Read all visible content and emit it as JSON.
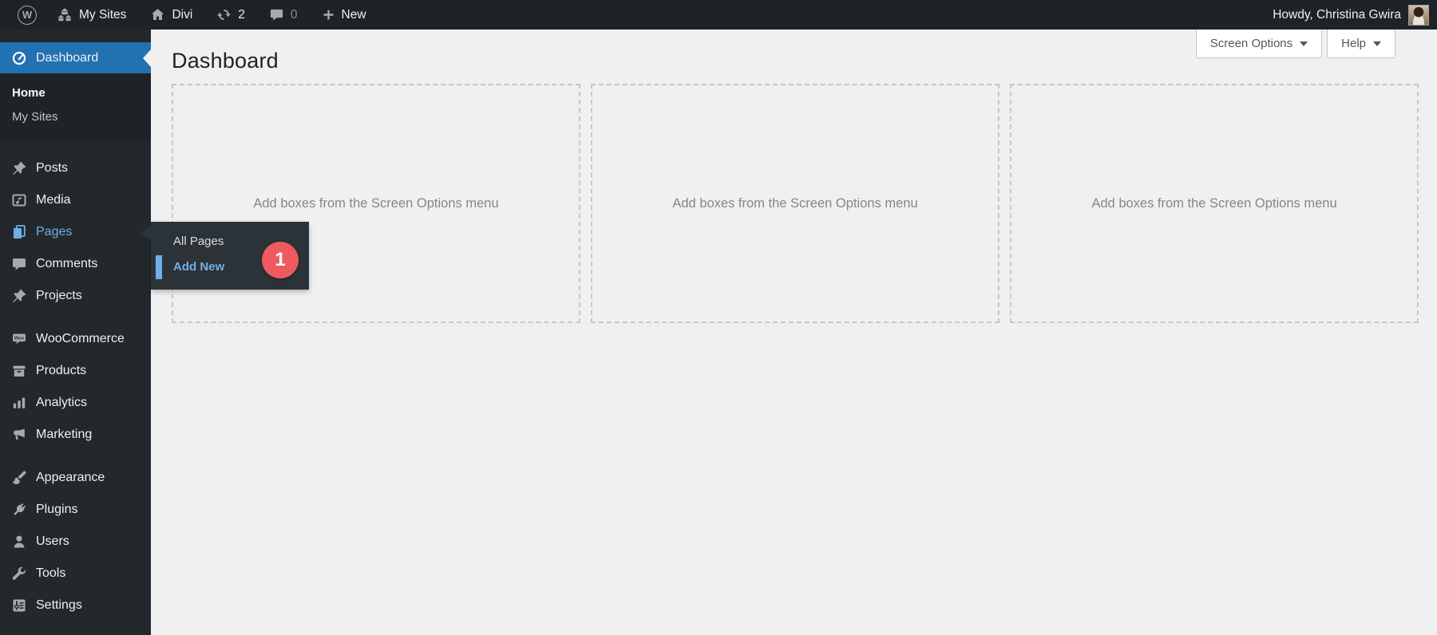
{
  "admin_bar": {
    "wp_logo_letter": "W",
    "my_sites_label": "My Sites",
    "site_name": "Divi",
    "update_count": "2",
    "comment_count": "0",
    "new_label": "New",
    "howdy": "Howdy, Christina Gwira"
  },
  "sidebar": {
    "dashboard_label": "Dashboard",
    "submenu": {
      "home": "Home",
      "my_sites": "My Sites"
    },
    "menu": [
      {
        "label": "Posts"
      },
      {
        "label": "Media"
      },
      {
        "label": "Pages"
      },
      {
        "label": "Comments"
      },
      {
        "label": "Projects"
      },
      {
        "label": "WooCommerce"
      },
      {
        "label": "Products"
      },
      {
        "label": "Analytics"
      },
      {
        "label": "Marketing"
      },
      {
        "label": "Appearance"
      },
      {
        "label": "Plugins"
      },
      {
        "label": "Users"
      },
      {
        "label": "Tools"
      },
      {
        "label": "Settings"
      }
    ]
  },
  "flyout": {
    "all_pages_label": "All Pages",
    "add_new_label": "Add New",
    "badge": "1"
  },
  "main": {
    "title": "Dashboard",
    "screen_options_label": "Screen Options",
    "help_label": "Help",
    "boxes": [
      {
        "text": "Add boxes from the Screen Options menu"
      },
      {
        "text": "Add boxes from the Screen Options menu"
      },
      {
        "text": "Add boxes from the Screen Options menu"
      }
    ]
  },
  "colors": {
    "admin_bar_bg": "#1d2327",
    "sidebar_bg": "#23282d",
    "submenu_bg": "#1d2327",
    "flyout_bg": "#2c3338",
    "active_blue": "#2271b1",
    "link_blue": "#72aee6",
    "badge_red": "#ee5a5f",
    "content_bg": "#f0f0f1"
  }
}
